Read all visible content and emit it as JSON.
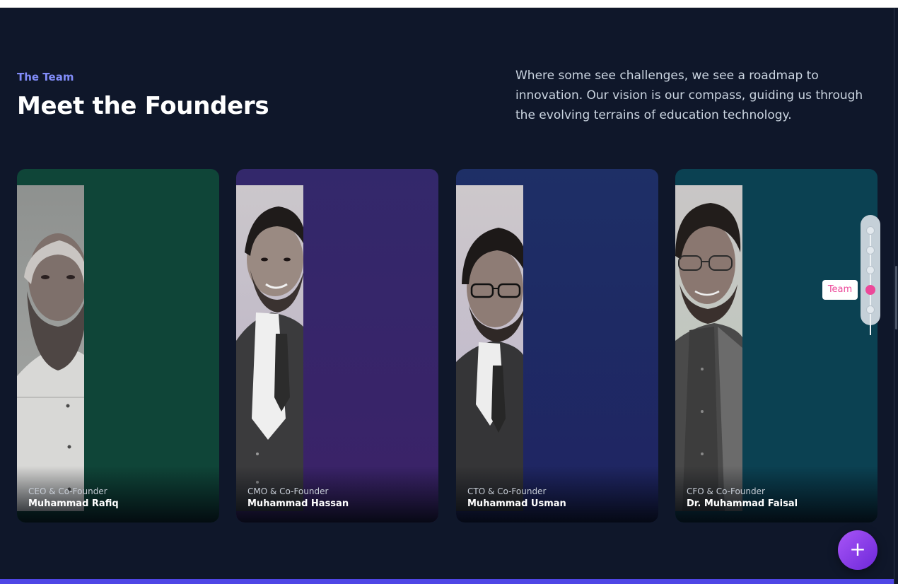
{
  "section": {
    "eyebrow": "The Team",
    "title": "Meet the Founders",
    "intro": "Where some see challenges, we see a roadmap to innovation. Our vision is our compass, guiding us through the evolving terrains of education technology."
  },
  "founders": [
    {
      "role": "CEO & Co-Founder",
      "name": "Muhammad Rafiq",
      "color": "#0f4538"
    },
    {
      "role": "CMO & Co-Founder",
      "name": "Muhammad Hassan",
      "color": "#33286b"
    },
    {
      "role": "CTO & Co-Founder",
      "name": "Muhammad Usman",
      "color": "#1e2f66"
    },
    {
      "role": "CFO & Co-Founder",
      "name": "Dr. Muhammad Faisal",
      "color": "#0b4152"
    }
  ],
  "nav_rail": {
    "active_label": "Team",
    "active_index": 3,
    "dot_count": 5
  },
  "fab": {
    "icon": "plus-icon",
    "glyph": "+"
  },
  "colors": {
    "accent": "#818cf8",
    "background": "#0f172a",
    "highlight": "#ec4899"
  }
}
